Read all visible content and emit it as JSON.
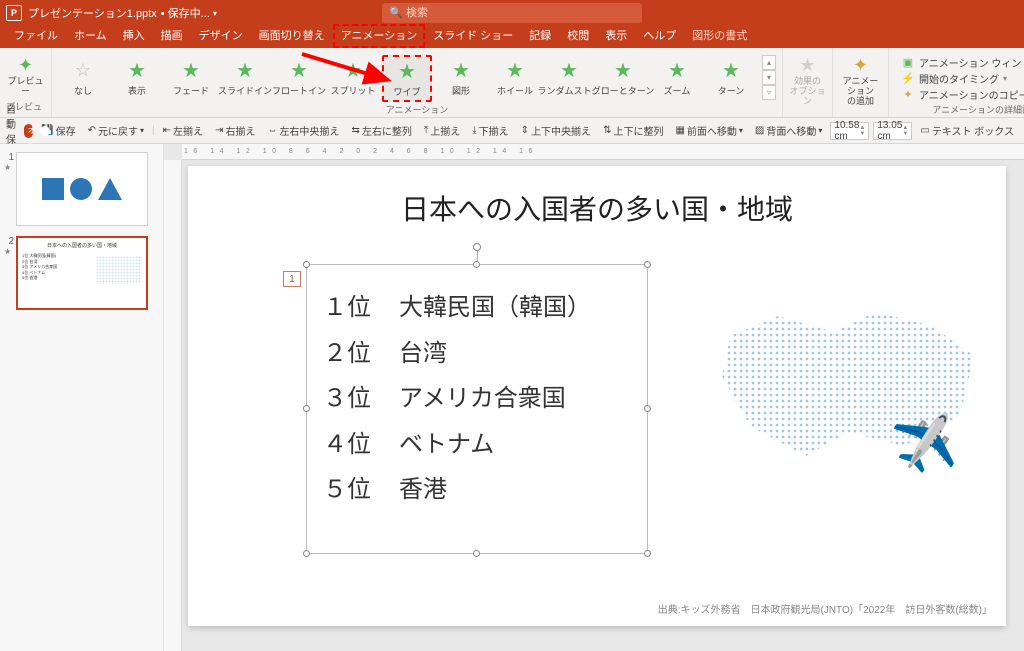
{
  "title_bar": {
    "filename": "プレゼンテーション1.pptx",
    "status": "• 保存中..."
  },
  "search": {
    "placeholder": "検索"
  },
  "menu": {
    "file": "ファイル",
    "home": "ホーム",
    "insert": "挿入",
    "draw": "描画",
    "design": "デザイン",
    "transitions": "画面切り替え",
    "animations": "アニメーション",
    "slideshow": "スライド ショー",
    "record": "記録",
    "review": "校閲",
    "view": "表示",
    "help": "ヘルプ",
    "shape_format": "図形の書式"
  },
  "ribbon": {
    "preview": {
      "label": "プレビュー",
      "group": "プレビュー"
    },
    "gallery": {
      "items": [
        {
          "name": "なし",
          "kind": "none"
        },
        {
          "name": "表示",
          "kind": "green"
        },
        {
          "name": "フェード",
          "kind": "green"
        },
        {
          "name": "スライドイン",
          "kind": "green"
        },
        {
          "name": "フロートイン",
          "kind": "green"
        },
        {
          "name": "スプリット",
          "kind": "green"
        },
        {
          "name": "ワイプ",
          "kind": "green",
          "selected": true,
          "highlight": true
        },
        {
          "name": "図形",
          "kind": "green"
        },
        {
          "name": "ホイール",
          "kind": "green"
        },
        {
          "name": "ランダムスト…",
          "kind": "green"
        },
        {
          "name": "グローとターン",
          "kind": "green"
        },
        {
          "name": "ズーム",
          "kind": "green"
        },
        {
          "name": "ターン",
          "kind": "green"
        }
      ],
      "group": "アニメーション"
    },
    "effect_options": {
      "label": "効果の\nオプション"
    },
    "add_anim": {
      "label": "アニメーション\nの追加"
    },
    "adv": {
      "pane": "アニメーション ウィンドウ",
      "trigger": "開始のタイミング",
      "painter": "アニメーションのコピー/貼り付け",
      "group": "アニメーションの詳細設定"
    }
  },
  "qat": {
    "autosave": "自動保存",
    "on": "オン",
    "save": "保存",
    "undo": "元に戻す",
    "align_left": "左揃え",
    "align_right": "右揃え",
    "align_ch": "左右中央揃え",
    "align_lr": "左右に整列",
    "align_top": "上揃え",
    "align_bottom": "下揃え",
    "align_cv": "上下中央揃え",
    "align_tb": "上下に整列",
    "front": "前面へ移動",
    "back": "背面へ移動",
    "h": "10.58 cm",
    "w": "13.05 cm",
    "textbox": "テキスト ボックス"
  },
  "ruler": "16 14 12 10 8 6 4 2 0 2 4 6 8 10 12 14 16",
  "slide": {
    "title": "日本への入国者の多い国・地域",
    "ranks": [
      {
        "n": "１位",
        "c": "大韓民国（韓国）"
      },
      {
        "n": "２位",
        "c": "台湾"
      },
      {
        "n": "３位",
        "c": "アメリカ合衆国"
      },
      {
        "n": "４位",
        "c": "ベトナム"
      },
      {
        "n": "５位",
        "c": "香港"
      }
    ],
    "tag": "1",
    "source": "出典:キッズ外務省　日本政府観光局(JNTO)「2022年　訪日外客数(総数)」"
  },
  "thumbs": {
    "n1": "1",
    "n2": "2",
    "star": "★",
    "t2_title": "日本への入国者の多い国・地域",
    "t2_list": "1位 大韓民国(韓国)\n2位 台湾\n3位 アメリカ合衆国\n4位 ベトナム\n5位 香港"
  }
}
